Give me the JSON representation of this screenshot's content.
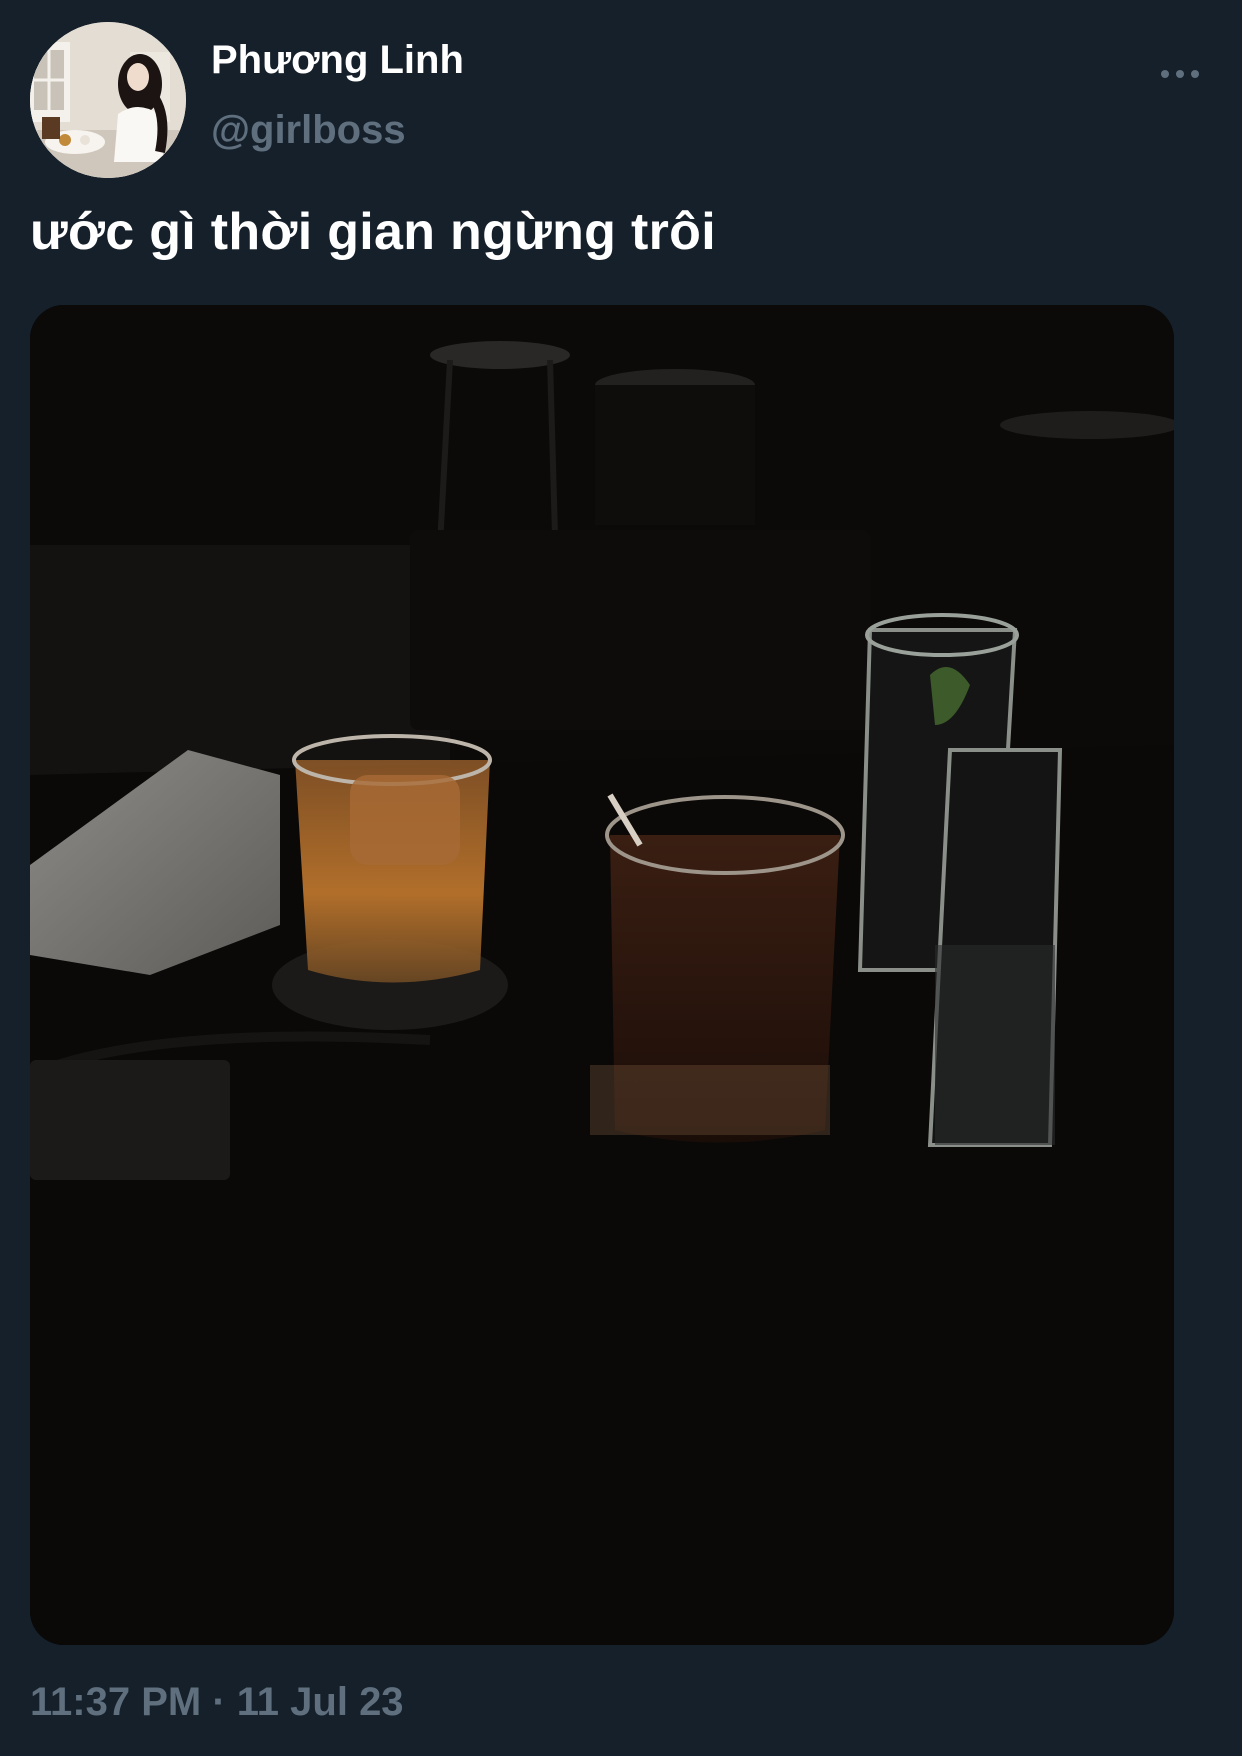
{
  "tweet": {
    "author": {
      "display_name": "Phương Linh",
      "handle": "@girlboss",
      "avatar_icon": "profile-photo"
    },
    "more_icon": "more-horizontal-icon",
    "text": "ước gì thời gian ngừng trôi",
    "media": {
      "kind": "photo",
      "subject": "dark bar table with cocktail glasses and water glasses"
    },
    "timestamp": "11:37 PM · 11 Jul 23"
  },
  "colors": {
    "background": "#15202b",
    "primary_text": "#ffffff",
    "secondary_text": "#5f6f7e"
  }
}
